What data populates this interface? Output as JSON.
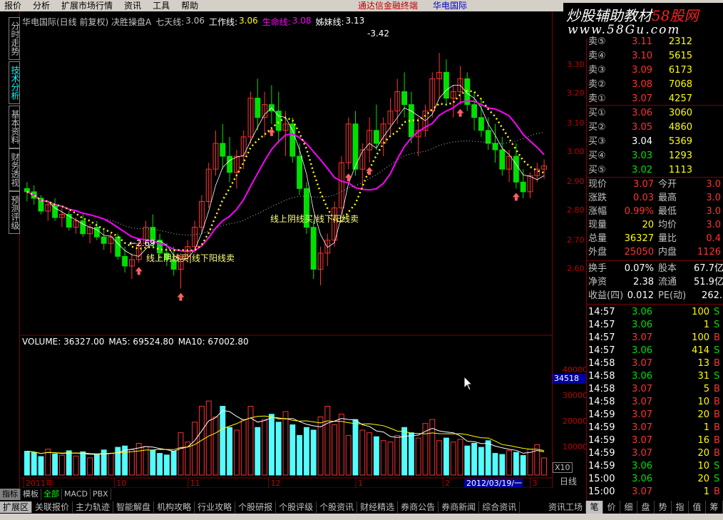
{
  "menu": [
    "报价",
    "分析",
    "扩展市场行情",
    "资讯",
    "工具",
    "帮助"
  ],
  "brand": "通达信金融终端",
  "brand_stock": "华电国际",
  "watermark": {
    "line1a": "炒股辅助教材",
    "line1b": "58股网",
    "line2": "www.58Gu.com"
  },
  "left_tabs": [
    "分时走势",
    "技术分析",
    "基本资料",
    "财务透视",
    "预测评级"
  ],
  "chart_header": {
    "title": "华电国际(日线 前复权) 决胜操盘A",
    "l1_label": "七天线:",
    "l1_value": "3.06",
    "l2_label": "工作线:",
    "l2_value": "3.06",
    "l3_label": "生命线:",
    "l3_value": "3.08",
    "l4_label": "姊妹线:",
    "l4_value": "3.13"
  },
  "annotations": {
    "high": "3.42",
    "low": "2.69",
    "text1": "线上阴线买|线下阳线卖",
    "text2": "线上阴线买|线下阳线卖"
  },
  "volume_header": {
    "vol": "VOLUME: 36327.00",
    "ma5": "MA5: 69524.80",
    "ma10": "MA10: 67002.80"
  },
  "price_ticks": [
    "3.30",
    "3.20",
    "3.10",
    "3.00",
    "2.90",
    "2.80",
    "2.70",
    "2.60"
  ],
  "volume_ticks": [
    "40000",
    "30000",
    "20000",
    "10000"
  ],
  "volume_current": "34518",
  "volume_unit": "X10",
  "date_labels": [
    "2011年",
    "10",
    "11",
    "12",
    "1",
    "2",
    "3"
  ],
  "date_cursor": "2012/03/19/一",
  "period": "日线",
  "colors": {
    "up": "#ff3232",
    "down": "#54fcfc",
    "green": "#00e000",
    "life": "#ff00ff",
    "seven": "#ffff00",
    "work": "#ffffff"
  },
  "order_book": [
    {
      "label": "卖⑤",
      "price": "3.11",
      "vol": "2312"
    },
    {
      "label": "卖④",
      "price": "3.10",
      "vol": "5615"
    },
    {
      "label": "卖③",
      "price": "3.09",
      "vol": "6173"
    },
    {
      "label": "卖②",
      "price": "3.08",
      "vol": "7068"
    },
    {
      "label": "卖①",
      "price": "3.07",
      "vol": "4257"
    },
    {
      "label": "买①",
      "price": "3.06",
      "vol": "3060"
    },
    {
      "label": "买②",
      "price": "3.05",
      "vol": "4860"
    },
    {
      "label": "买③",
      "price": "3.04",
      "vol": "5369"
    },
    {
      "label": "买④",
      "price": "3.03",
      "vol": "1293"
    },
    {
      "label": "买⑤",
      "price": "3.02",
      "vol": "1113"
    }
  ],
  "quote": [
    {
      "l": "现价",
      "v": "3.07",
      "l2": "今开",
      "v2": "3.0"
    },
    {
      "l": "涨跌",
      "v": "0.03",
      "l2": "最高",
      "v2": "3.0"
    },
    {
      "l": "涨幅",
      "v": "0.99%",
      "l2": "最低",
      "v2": "3.0"
    },
    {
      "l": "现量",
      "v": "20",
      "l2": "均价",
      "v2": "3.0"
    },
    {
      "l": "总量",
      "v": "36327",
      "l2": "量比",
      "v2": "0.4"
    },
    {
      "l": "外盘",
      "v": "25050",
      "l2": "内盘",
      "v2": "1126"
    }
  ],
  "stats": [
    {
      "l": "换手",
      "v": "0.07%",
      "l2": "股本",
      "v2": "67.7亿"
    },
    {
      "l": "净资",
      "v": "2.38",
      "l2": "流通",
      "v2": "51.9亿"
    },
    {
      "l": "收益(四)",
      "v": "0.012",
      "l2": "PE(动)",
      "v2": "262."
    }
  ],
  "ticks": [
    {
      "t": "14:57",
      "p": "3.06",
      "v": "100",
      "d": "S"
    },
    {
      "t": "14:57",
      "p": "3.06",
      "v": "1",
      "d": "S"
    },
    {
      "t": "14:57",
      "p": "3.07",
      "v": "100",
      "d": "B"
    },
    {
      "t": "14:57",
      "p": "3.06",
      "v": "414",
      "d": "S"
    },
    {
      "t": "14:58",
      "p": "3.07",
      "v": "13",
      "d": "B"
    },
    {
      "t": "14:58",
      "p": "3.06",
      "v": "31",
      "d": "S"
    },
    {
      "t": "14:58",
      "p": "3.07",
      "v": "5",
      "d": "B"
    },
    {
      "t": "14:58",
      "p": "3.07",
      "v": "10",
      "d": "B"
    },
    {
      "t": "14:59",
      "p": "3.07",
      "v": "20",
      "d": "B"
    },
    {
      "t": "14:59",
      "p": "3.07",
      "v": "1",
      "d": "B"
    },
    {
      "t": "14:59",
      "p": "3.07",
      "v": "16",
      "d": "B"
    },
    {
      "t": "14:59",
      "p": "3.07",
      "v": "20",
      "d": "B"
    },
    {
      "t": "14:59",
      "p": "3.06",
      "v": "10",
      "d": "S"
    },
    {
      "t": "15:00",
      "p": "3.06",
      "v": "20",
      "d": "S"
    },
    {
      "t": "15:00",
      "p": "3.07",
      "v": "1",
      "d": "B"
    }
  ],
  "bottom_tabs": [
    "指标",
    "模板",
    "全部",
    "MACD",
    "PBX"
  ],
  "bottom_bar": [
    "扩展区",
    "关联报价",
    "主力轨迹",
    "智能解盘",
    "机构攻略",
    "行业攻略",
    "个股研报",
    "个股评级",
    "个股资讯",
    "财经精选",
    "券商公告",
    "券商新闻",
    "综合资讯",
    "资讯工场"
  ],
  "right_tabs": [
    "笔",
    "价",
    "细",
    "盘",
    "势",
    "指",
    "值",
    "筹"
  ],
  "chart_data": {
    "type": "candlestick",
    "ylim": [
      2.55,
      3.5
    ],
    "volume_ylim": [
      0,
      48000
    ],
    "candles": [
      [
        3.0,
        3.02,
        2.96,
        2.99
      ],
      [
        2.99,
        3.01,
        2.95,
        2.97
      ],
      [
        2.97,
        2.98,
        2.92,
        2.93
      ],
      [
        2.93,
        2.96,
        2.9,
        2.95
      ],
      [
        2.95,
        2.97,
        2.9,
        2.91
      ],
      [
        2.91,
        2.94,
        2.88,
        2.92
      ],
      [
        2.92,
        2.93,
        2.87,
        2.88
      ],
      [
        2.88,
        2.91,
        2.86,
        2.9
      ],
      [
        2.9,
        2.92,
        2.85,
        2.86
      ],
      [
        2.86,
        2.89,
        2.83,
        2.88
      ],
      [
        2.88,
        2.9,
        2.84,
        2.85
      ],
      [
        2.85,
        2.87,
        2.81,
        2.83
      ],
      [
        2.83,
        2.86,
        2.8,
        2.85
      ],
      [
        2.85,
        2.86,
        2.78,
        2.79
      ],
      [
        2.79,
        2.82,
        2.74,
        2.76
      ],
      [
        2.76,
        2.8,
        2.72,
        2.78
      ],
      [
        2.78,
        2.84,
        2.77,
        2.83
      ],
      [
        2.83,
        2.9,
        2.82,
        2.88
      ],
      [
        2.88,
        2.92,
        2.82,
        2.84
      ],
      [
        2.84,
        2.86,
        2.78,
        2.8
      ],
      [
        2.8,
        2.83,
        2.76,
        2.78
      ],
      [
        2.78,
        2.82,
        2.73,
        2.75
      ],
      [
        2.75,
        2.8,
        2.69,
        2.79
      ],
      [
        2.79,
        2.84,
        2.77,
        2.82
      ],
      [
        2.82,
        2.9,
        2.8,
        2.88
      ],
      [
        2.88,
        2.98,
        2.86,
        2.96
      ],
      [
        2.96,
        3.08,
        2.94,
        3.06
      ],
      [
        3.06,
        3.18,
        3.04,
        3.14
      ],
      [
        3.14,
        3.2,
        3.06,
        3.1
      ],
      [
        3.1,
        3.16,
        3.02,
        3.05
      ],
      [
        3.05,
        3.12,
        3.0,
        3.1
      ],
      [
        3.1,
        3.18,
        3.06,
        3.16
      ],
      [
        3.16,
        3.3,
        3.14,
        3.28
      ],
      [
        3.28,
        3.34,
        3.18,
        3.22
      ],
      [
        3.22,
        3.3,
        3.16,
        3.26
      ],
      [
        3.26,
        3.32,
        3.2,
        3.24
      ],
      [
        3.24,
        3.3,
        3.14,
        3.18
      ],
      [
        3.18,
        3.24,
        3.1,
        3.2
      ],
      [
        3.2,
        3.22,
        3.08,
        3.1
      ],
      [
        3.1,
        3.14,
        2.98,
        3.0
      ],
      [
        3.0,
        3.02,
        2.86,
        2.88
      ],
      [
        2.88,
        2.9,
        2.72,
        2.75
      ],
      [
        2.75,
        2.82,
        2.7,
        2.8
      ],
      [
        2.8,
        2.86,
        2.76,
        2.84
      ],
      [
        2.84,
        2.96,
        2.82,
        2.94
      ],
      [
        2.94,
        3.1,
        2.92,
        3.08
      ],
      [
        3.08,
        3.22,
        3.06,
        3.2
      ],
      [
        3.2,
        3.24,
        3.04,
        3.06
      ],
      [
        3.06,
        3.14,
        3.0,
        3.12
      ],
      [
        3.12,
        3.22,
        3.08,
        3.18
      ],
      [
        3.18,
        3.26,
        3.12,
        3.14
      ],
      [
        3.14,
        3.22,
        3.1,
        3.2
      ],
      [
        3.2,
        3.28,
        3.16,
        3.24
      ],
      [
        3.24,
        3.34,
        3.2,
        3.3
      ],
      [
        3.3,
        3.36,
        3.22,
        3.26
      ],
      [
        3.26,
        3.3,
        3.14,
        3.16
      ],
      [
        3.16,
        3.22,
        3.1,
        3.18
      ],
      [
        3.18,
        3.26,
        3.16,
        3.24
      ],
      [
        3.24,
        3.36,
        3.22,
        3.34
      ],
      [
        3.34,
        3.42,
        3.28,
        3.36
      ],
      [
        3.36,
        3.4,
        3.26,
        3.28
      ],
      [
        3.28,
        3.32,
        3.22,
        3.3
      ],
      [
        3.3,
        3.38,
        3.26,
        3.34
      ],
      [
        3.34,
        3.36,
        3.24,
        3.26
      ],
      [
        3.26,
        3.3,
        3.18,
        3.22
      ],
      [
        3.22,
        3.28,
        3.16,
        3.18
      ],
      [
        3.18,
        3.22,
        3.12,
        3.14
      ],
      [
        3.14,
        3.2,
        3.08,
        3.12
      ],
      [
        3.12,
        3.16,
        3.04,
        3.06
      ],
      [
        3.06,
        3.12,
        3.02,
        3.1
      ],
      [
        3.1,
        3.14,
        3.0,
        3.02
      ],
      [
        3.02,
        3.06,
        2.97,
        2.99
      ],
      [
        2.99,
        3.05,
        2.97,
        3.04
      ],
      [
        3.04,
        3.08,
        3.02,
        3.06
      ],
      [
        3.06,
        3.09,
        3.03,
        3.07
      ]
    ],
    "volume": [
      9000,
      8500,
      7000,
      9800,
      8000,
      7500,
      9200,
      7200,
      8800,
      6500,
      7800,
      9500,
      8200,
      10500,
      11000,
      9600,
      12000,
      10800,
      9400,
      8200,
      7600,
      9000,
      16000,
      12500,
      20000,
      26000,
      28000,
      22000,
      26000,
      18000,
      17000,
      21000,
      26000,
      18000,
      21000,
      23000,
      20000,
      24000,
      19000,
      15000,
      18000,
      17000,
      22000,
      26000,
      19000,
      23000,
      15000,
      21000,
      17000,
      16000,
      14500,
      13000,
      12500,
      15000,
      18000,
      16000,
      14000,
      19500,
      21000,
      13000,
      14000,
      12500,
      13500,
      11000,
      12000,
      10500,
      13000,
      8200,
      7800,
      9200,
      8600,
      7400,
      9800,
      11500,
      6500
    ],
    "volume_peaks": {
      "max": 48000,
      "b1": 34000
    }
  }
}
